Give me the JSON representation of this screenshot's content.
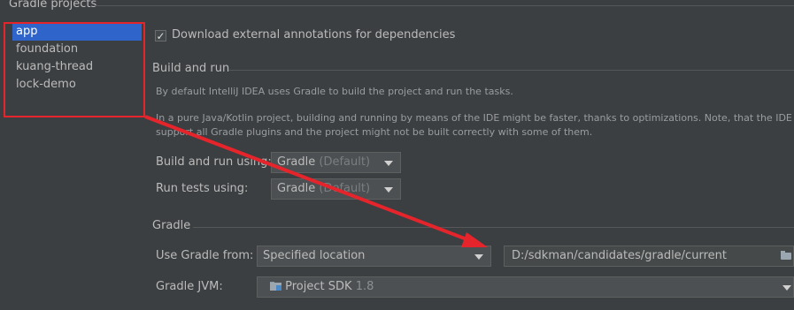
{
  "section_title": "Gradle projects",
  "projects": [
    {
      "label": "app",
      "selected": true
    },
    {
      "label": "foundation",
      "selected": false
    },
    {
      "label": "kuang-thread",
      "selected": false
    },
    {
      "label": "lock-demo",
      "selected": false
    }
  ],
  "download_annotations": {
    "label": "Download external annotations for dependencies",
    "checked": true
  },
  "build_and_run": {
    "title": "Build and run",
    "desc1": "By default IntelliJ IDEA uses Gradle to build the project and run the tasks.",
    "desc2": "In a pure Java/Kotlin project, building and running by means of the IDE might be faster, thanks to optimizations. Note, that the IDE doesn't",
    "desc3": "support all Gradle plugins and the project might not be built correctly with some of them.",
    "build_label": "Build and run using:",
    "build_value": "Gradle",
    "build_suffix": "(Default)",
    "tests_label": "Run tests using:",
    "tests_value": "Gradle",
    "tests_suffix": "(Default)"
  },
  "gradle": {
    "title": "Gradle",
    "use_from_label": "Use Gradle from:",
    "use_from_value": "Specified location",
    "location_value": "D:/sdkman/candidates/gradle/current",
    "jvm_label": "Gradle JVM:",
    "jvm_value": "Project SDK",
    "jvm_version": "1.8"
  },
  "colors": {
    "background": "#3c3f41",
    "selection": "#2f65ca",
    "annotation_red": "#e5242b"
  },
  "icons": [
    "checkmark-icon",
    "dropdown-arrow-icon",
    "folder-icon",
    "sdk-folder-icon"
  ]
}
